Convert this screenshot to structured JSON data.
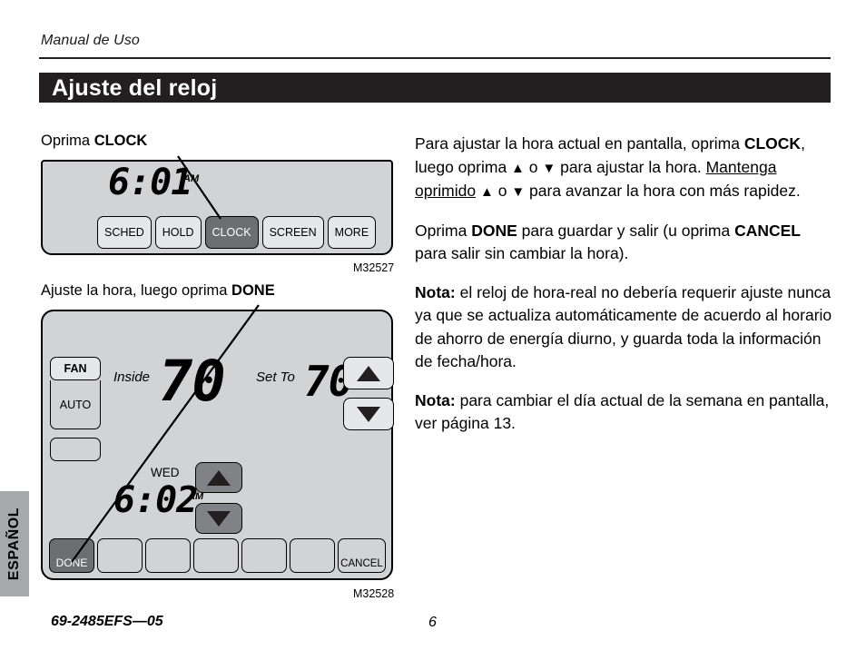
{
  "page": {
    "running_head": "Manual de Uso",
    "section_title": "Ajuste del reloj",
    "lang_tab": "ESPAÑOL",
    "footer_code": "69-2485EFS—05",
    "footer_page": "6"
  },
  "figure_1": {
    "caption_prefix": "Oprima ",
    "caption_bold": "CLOCK",
    "figure_id": "M32527",
    "display": {
      "time": "6:01",
      "ampm": "AM"
    },
    "soft_keys": [
      {
        "label": "SCHED",
        "active": false
      },
      {
        "label": "HOLD",
        "active": false
      },
      {
        "label": "CLOCK",
        "active": true
      },
      {
        "label": "SCREEN",
        "active": false
      },
      {
        "label": "MORE",
        "active": false
      }
    ]
  },
  "figure_2": {
    "caption_prefix": "Ajuste la hora, luego oprima ",
    "caption_bold": "DONE",
    "figure_id": "M32528",
    "fan": {
      "mode_label": "FAN",
      "state_label": "AUTO"
    },
    "display": {
      "inside_label": "Inside",
      "inside_temp": "70",
      "set_to_label": "Set To",
      "set_to_temp": "70",
      "day": "WED",
      "time": "6:02",
      "ampm": "AM"
    },
    "temp_pads": {
      "up": "up-arrow",
      "down": "down-arrow"
    },
    "clock_pads": {
      "up": "up-arrow",
      "down": "down-arrow"
    },
    "soft_keys": [
      {
        "label": "DONE",
        "active": true
      },
      {
        "label": "",
        "active": false
      },
      {
        "label": "",
        "active": false
      },
      {
        "label": "",
        "active": false
      },
      {
        "label": "",
        "active": false
      },
      {
        "label": "",
        "active": false
      },
      {
        "label": "CANCEL",
        "active": false
      }
    ]
  },
  "body_text": {
    "p1": {
      "s1": "Para ajustar la hora actual en pantalla, oprima ",
      "b1": "CLOCK",
      "s2": ", luego oprima ",
      "g1": "▲",
      "s3": " o ",
      "g2": "▼",
      "s4": " para ajustar la hora. ",
      "u1": "Mantenga oprimido",
      "s5": " ",
      "g3": "▲",
      "s6": " o ",
      "g4": "▼",
      "s7": " para avanzar la hora con más rapidez."
    },
    "p2": {
      "s1": "Oprima ",
      "b1": "DONE",
      "s2": " para guardar y salir (u oprima ",
      "b2": "CANCEL",
      "s3": " para salir sin cambiar la hora)."
    },
    "p3": {
      "b1": "Nota:",
      "s1": " el reloj de hora-real no debería requerir ajuste nunca ya que se actualiza automáticamente de acuerdo al horario de ahorro de energía diurno, y guarda toda la información de fecha/hora."
    },
    "p4": {
      "b1": "Nota:",
      "s1": " para cambiar el día actual de la semana en pantalla, ver página 13."
    }
  }
}
